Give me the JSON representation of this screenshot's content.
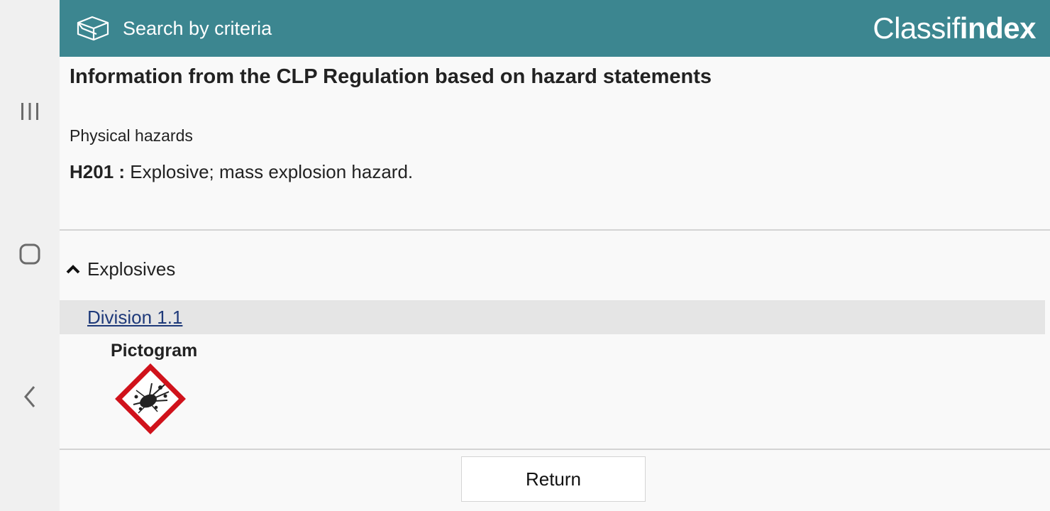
{
  "header": {
    "title": "Search by criteria",
    "icon": "open-box-icon",
    "logo_light": "Classif",
    "logo_bold": "index",
    "background": "#3c8690"
  },
  "nav": {
    "recents_icon": "recent-apps-icon",
    "home_icon": "home-icon",
    "back_icon": "back-icon"
  },
  "content": {
    "title": "Information from the CLP Regulation based on hazard statements",
    "section": "Physical hazards",
    "statement": {
      "code": "H201 :",
      "text": "Explosive; mass explosion hazard."
    },
    "category": {
      "label": "Explosives",
      "icon": "chevron-up-icon"
    },
    "division": {
      "label": "Division 1.1",
      "color": "#1f3a7a"
    },
    "pictogram_label": "Pictogram",
    "pictogram_icon": "exploding-bomb-icon",
    "pictogram_color": "#d0121b",
    "return_label": "Return"
  }
}
